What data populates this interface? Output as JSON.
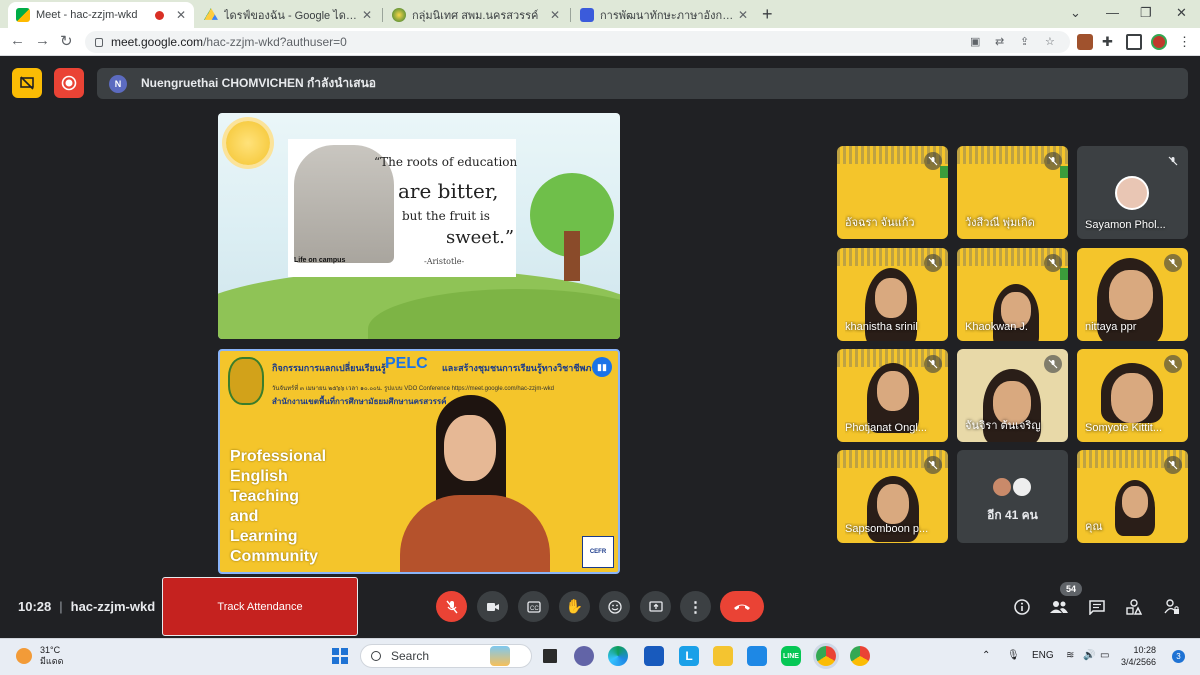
{
  "browser": {
    "tabs": [
      {
        "title": "Meet - hac-zzjm-wkd",
        "active": true,
        "recording": true
      },
      {
        "title": "ไดรฟ์ของฉัน - Google ไดรฟ์",
        "active": false
      },
      {
        "title": "กลุ่มนิเทศ สพม.นครสวรรค์",
        "active": false
      },
      {
        "title": "การพัฒนาทักษะภาษาอังกฤษ English",
        "active": false
      }
    ],
    "address": {
      "host": "meet.google.com",
      "path": "/hac-zzjm-wkd?authuser=0"
    }
  },
  "meet": {
    "presenter_initial": "N",
    "presenter_text": "Nuengruethai CHOMVICHEN กำลังนำเสนอ",
    "slide": {
      "logo_text": "Life on campus",
      "quote_line1": "“The roots of education",
      "quote_line2": "are bitter,",
      "quote_line3": "but the fruit is",
      "quote_line4": "sweet.”",
      "attribution": "-Aristotle-"
    },
    "video": {
      "banner_title": "กิจกรรมการแลกเปลี่ยนเรียนรู้",
      "banner_brand": "PELC",
      "banner_subtitle": "และสร้างชุมชนการเรียนรู้ทางวิชาชีพภาษา",
      "banner_date": "วันจันทร์ที่ ๓ เมษายน ๒๕๖๖ เวลา ๑๐.๐๐น. รูปแบบ VDO Conference https://meet.google.com/hac-zzjm-wkd",
      "banner_org": "สำนักงานเขตพื้นที่การศึกษามัธยมศึกษานครสวรรค์",
      "title_lines": [
        "Professional",
        "English",
        "Teaching",
        "and",
        "Learning",
        "Community"
      ],
      "badge": "CEFR"
    },
    "participants": [
      {
        "name": "อัจฉรา จันแก้ว",
        "type": "slide"
      },
      {
        "name": "วังสีวณี พุ่มเกิด",
        "type": "slide"
      },
      {
        "name": "Sayamon Phol...",
        "type": "avatar"
      },
      {
        "name": "khanistha srinil",
        "type": "video"
      },
      {
        "name": "Khaokwan J.",
        "type": "video"
      },
      {
        "name": "nittaya ppr",
        "type": "video"
      },
      {
        "name": "Photjanat Ongl...",
        "type": "video"
      },
      {
        "name": "จันจิรา ต้นเจริญ",
        "type": "video"
      },
      {
        "name": "Somyote Kittit...",
        "type": "video"
      },
      {
        "name": "Sapsomboon p...",
        "type": "video"
      },
      {
        "name": "อีก 41 คน",
        "type": "more"
      },
      {
        "name": "คุณ",
        "type": "self"
      }
    ],
    "time": "10:28",
    "meeting_code": "hac-zzjm-wkd",
    "track_attendance_label": "Track Attendance",
    "participant_count": "54"
  },
  "taskbar": {
    "temperature": "31°C",
    "weather_text": "มีแดด",
    "search_label": "Search",
    "language": "ENG",
    "clock_time": "10:28",
    "clock_date": "3/4/2566",
    "notification_count": "3"
  },
  "colors": {
    "meet_bg": "#202124",
    "control_bg": "#3c4043",
    "end_call": "#ea4335",
    "track_button": "#c5221f",
    "tile_yellow": "#f4c52b",
    "speaking_border": "#8ab4f8"
  }
}
